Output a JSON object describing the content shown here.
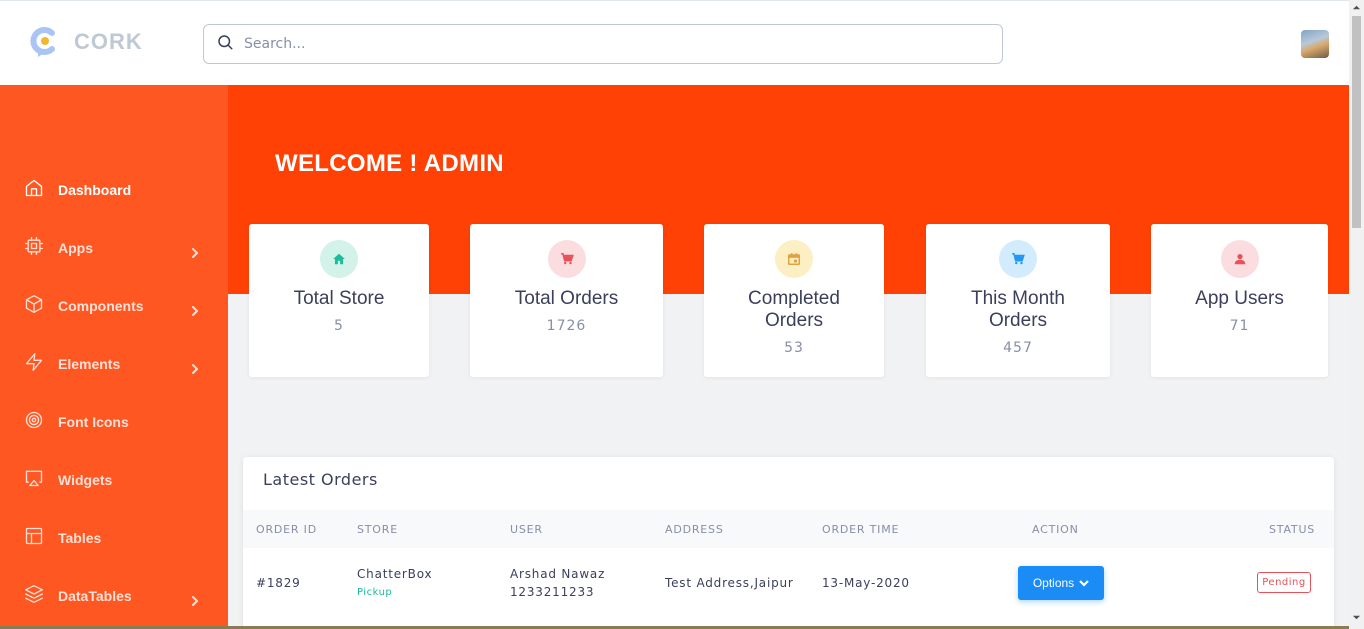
{
  "brand": {
    "name": "CORK"
  },
  "search": {
    "placeholder": "Search..."
  },
  "sidebar": {
    "items": [
      {
        "label": "Dashboard",
        "icon": "home-icon",
        "has_submenu": false
      },
      {
        "label": "Apps",
        "icon": "cpu-icon",
        "has_submenu": true
      },
      {
        "label": "Components",
        "icon": "box-icon",
        "has_submenu": true
      },
      {
        "label": "Elements",
        "icon": "zap-icon",
        "has_submenu": true
      },
      {
        "label": "Font Icons",
        "icon": "target-icon",
        "has_submenu": false
      },
      {
        "label": "Widgets",
        "icon": "airplay-icon",
        "has_submenu": false
      },
      {
        "label": "Tables",
        "icon": "layout-icon",
        "has_submenu": false
      },
      {
        "label": "DataTables",
        "icon": "layers-icon",
        "has_submenu": true
      }
    ]
  },
  "banner": {
    "welcome": "WELCOME ! ADMIN"
  },
  "stats": [
    {
      "title": "Total Store",
      "value": "5",
      "icon": "home-icon",
      "color": "#1abc9c"
    },
    {
      "title": "Total Orders",
      "value": "1726",
      "icon": "cart-icon",
      "color": "#e7515a"
    },
    {
      "title": "Completed Orders",
      "value": "53",
      "icon": "calendar-icon",
      "color": "#e2a03f"
    },
    {
      "title": "This Month Orders",
      "value": "457",
      "icon": "cart-icon",
      "color": "#2196f3"
    },
    {
      "title": "App Users",
      "value": "71",
      "icon": "user-icon",
      "color": "#e7515a"
    }
  ],
  "orders": {
    "title": "Latest Orders",
    "columns": [
      "ORDER ID",
      "STORE",
      "USER",
      "ADDRESS",
      "ORDER TIME",
      "ACTION",
      "STATUS"
    ],
    "rows": [
      {
        "order_id": "#1829",
        "store": "ChatterBox",
        "store_type": "Pickup",
        "user_name": "Arshad Nawaz",
        "user_phone": "1233211233",
        "address": "Test Address,Jaipur",
        "order_time": "13-May-2020",
        "action": "Options",
        "status": "Pending"
      }
    ]
  },
  "colors": {
    "sidebar": "#ff5722",
    "banner": "#ff4105",
    "primary_button": "#1b8cf5",
    "pending": "#e7515a",
    "pickup": "#1abc9c"
  }
}
